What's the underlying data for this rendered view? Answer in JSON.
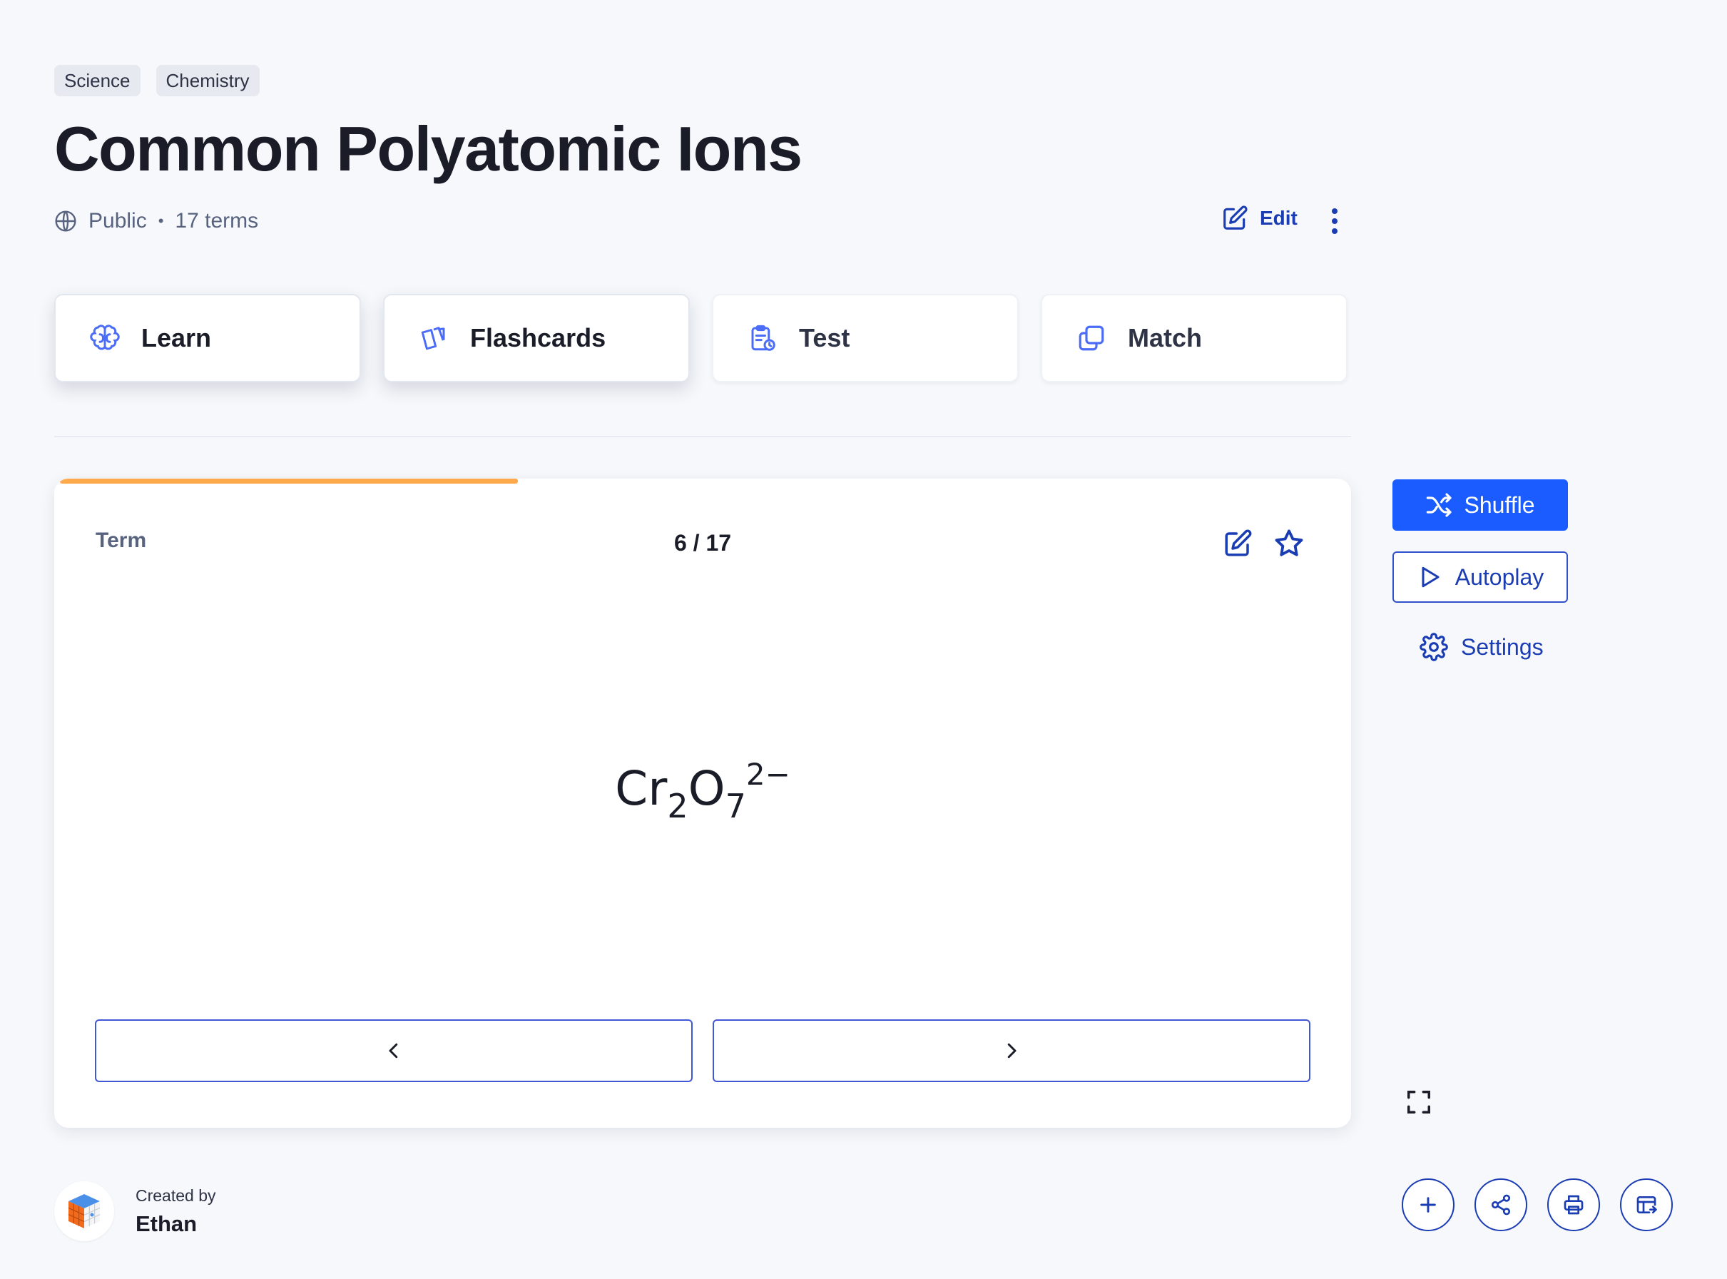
{
  "tags": [
    "Science",
    "Chemistry"
  ],
  "title": "Common Polyatomic Ions",
  "meta": {
    "visibility": "Public",
    "separator": "•",
    "term_count": "17 terms"
  },
  "actions": {
    "edit_label": "Edit",
    "more_icon": "more-vertical-icon"
  },
  "modes": [
    {
      "label": "Learn",
      "icon": "brain-icon"
    },
    {
      "label": "Flashcards",
      "icon": "cards-icon"
    },
    {
      "label": "Test",
      "icon": "test-clipboard-icon"
    },
    {
      "label": "Match",
      "icon": "match-copy-icon"
    }
  ],
  "card": {
    "side_label": "Term",
    "counter": "6 / 17",
    "progress_fraction": 0.353,
    "progress_color": "#ffa94d",
    "formula": {
      "base1": "Cr",
      "sub1": "2",
      "base2": "O",
      "sub2": "7",
      "charge": "2−"
    }
  },
  "controls": {
    "shuffle_label": "Shuffle",
    "autoplay_label": "Autoplay",
    "settings_label": "Settings"
  },
  "creator": {
    "label": "Created by",
    "name": "Ethan"
  },
  "colors": {
    "accent": "#1a5cff",
    "link": "#1b3db4",
    "background": "#f6f8fb"
  }
}
